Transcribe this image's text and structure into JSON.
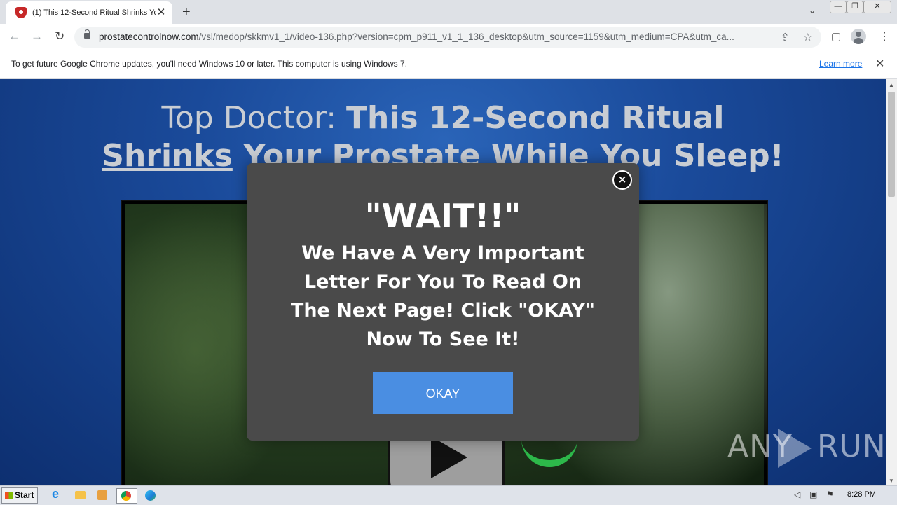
{
  "browser": {
    "tab_title": "(1) This 12-Second Ritual Shrinks Your Prostate While You Sleep!",
    "url_domain": "prostatecontrolnow.com",
    "url_path": "/vsl/medop/skkmv1_1/video-136.php?version=cpm_p911_v1_1_136_desktop&utm_source=1159&utm_medium=CPA&utm_ca..."
  },
  "infobar": {
    "text": "To get future Google Chrome updates, you'll need Windows 10 or later. This computer is using Windows 7.",
    "link": "Learn more"
  },
  "page": {
    "headline_prefix": "Top Doctor: ",
    "headline_bold": "This 12-Second Ritual",
    "headline_line2_underlined": "Shrinks",
    "headline_line2_rest": " Your Prostate While You Sleep!"
  },
  "modal": {
    "title": "\"WAIT!!\"",
    "message": "We Have A Very Important Letter For You To Read On The Next Page! Click \"OKAY\" Now To See It!",
    "button": "OKAY",
    "close_glyph": "×"
  },
  "watermark": {
    "left": "ANY",
    "right": "RUN"
  },
  "taskbar": {
    "start_label": "Start",
    "clock": "8:28 PM"
  },
  "icons": {
    "close": "✕",
    "plus": "+",
    "back": "←",
    "forward": "→",
    "reload": "↻",
    "star": "☆",
    "share": "⇪",
    "sidepanel": "▢",
    "dots": "⋮",
    "chevron": "⌄",
    "minimize": "—",
    "restore": "❐",
    "window_close": "✕"
  },
  "colors": {
    "modal_bg": "#4a4a4a",
    "button_bg": "#4a8ee2",
    "page_bg": "#1a4a9a"
  }
}
